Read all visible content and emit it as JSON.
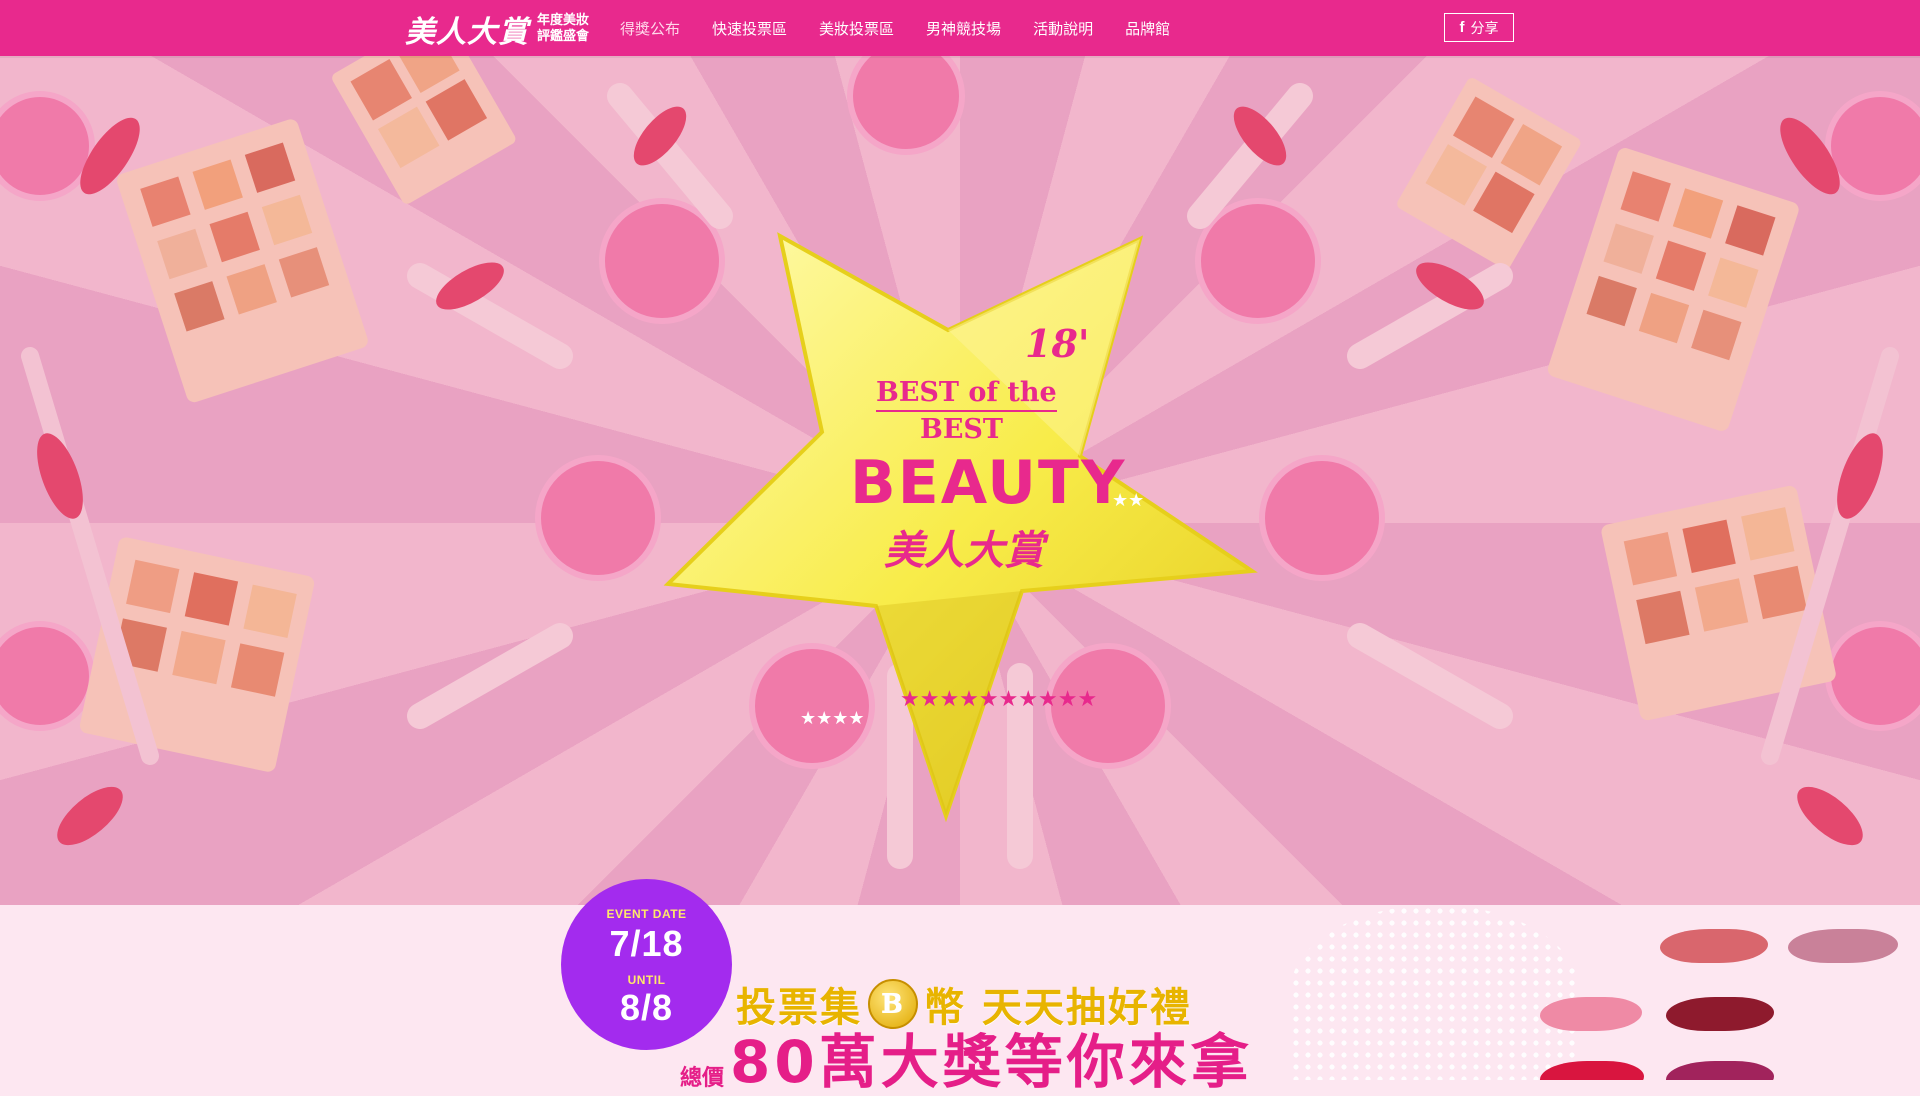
{
  "header": {
    "logo_main": "美人大賞",
    "logo_sub_line1": "年度美妝",
    "logo_sub_line2": "評鑑盛會",
    "nav": [
      "得獎公布",
      "快速投票區",
      "美妝投票區",
      "男神競技場",
      "活動說明",
      "品牌館"
    ],
    "share_label": "分享",
    "share_icon": "facebook-icon"
  },
  "hero": {
    "year": "18'",
    "line1": "BEST of the",
    "line2": "BEST",
    "brand_en": "BEAUTY",
    "brand_zh": "美人大賞"
  },
  "promo": {
    "event_date_label": "EVENT DATE",
    "start_date": "7/18",
    "until_label": "UNTIL",
    "end_date": "8/8",
    "headline_part1": "投票集",
    "coin_letter": "B",
    "headline_part2": "幣 天天抽好禮",
    "headline2_small": "總價",
    "headline2_big": "80萬大獎等你來拿"
  },
  "colors": {
    "brand_pink": "#e8298d",
    "badge_purple": "#a32bee",
    "gold": "#e8b400",
    "star_yellow": "#fbf26a"
  }
}
